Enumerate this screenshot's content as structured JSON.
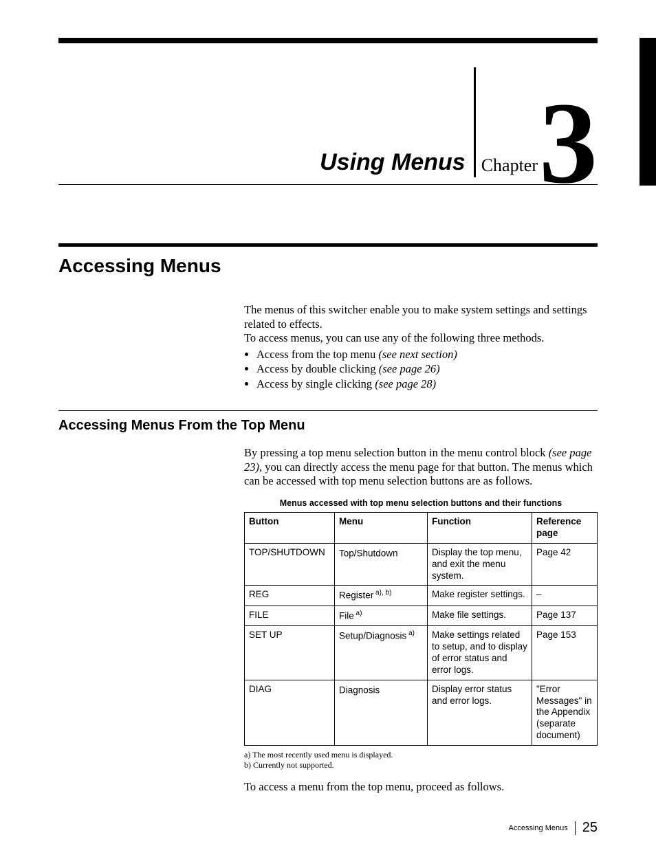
{
  "chapter": {
    "title": "Using Menus",
    "word": "Chapter",
    "number": "3"
  },
  "section": {
    "title": "Accessing Menus",
    "intro1": "The menus of this switcher enable you to make system settings and settings related to effects.",
    "intro2": "To access menus, you can use any of the following three methods.",
    "bullets": [
      {
        "text": "Access from the top menu ",
        "ref": "(see next section)"
      },
      {
        "text": "Access by double clicking ",
        "ref": "(see page 26)"
      },
      {
        "text": "Access by single clicking ",
        "ref": "(see page 28)"
      }
    ]
  },
  "subsection": {
    "title": "Accessing Menus From the Top Menu",
    "para_a": "By pressing a top menu selection button in the menu control block ",
    "para_ref": "(see page 23)",
    "para_b": ", you can directly access the menu page for that button. The menus which can be accessed with top menu selection buttons are as follows."
  },
  "table": {
    "caption": "Menus accessed with top menu selection buttons and their functions",
    "headers": {
      "c1": "Button",
      "c2": "Menu",
      "c3": "Function",
      "c4": "Reference page"
    },
    "rows": [
      {
        "button": "TOP/SHUTDOWN",
        "menu": "Top/Shutdown",
        "menu_sup": "",
        "func": "Display the top menu, and exit the menu system.",
        "ref": "Page 42"
      },
      {
        "button": "REG",
        "menu": "Register",
        "menu_sup": " a), b)",
        "func": "Make register settings.",
        "ref": "–"
      },
      {
        "button": "FILE",
        "menu": "File",
        "menu_sup": " a)",
        "func": "Make file settings.",
        "ref": "Page 137"
      },
      {
        "button": "SET UP",
        "menu": "Setup/Diagnosis",
        "menu_sup": " a)",
        "func": "Make settings related to setup, and to display of error status and error logs.",
        "ref": "Page 153"
      },
      {
        "button": "DIAG",
        "menu": "Diagnosis",
        "menu_sup": "",
        "func": "Display error status and error logs.",
        "ref": "\"Error Messages\" in the Appendix (separate document)"
      }
    ]
  },
  "footnotes": {
    "a": "a) The most recently used menu is displayed.",
    "b": "b) Currently not supported."
  },
  "closing": "To access a menu from the top menu, proceed as follows.",
  "footer": {
    "label": "Accessing Menus",
    "page": "25"
  }
}
